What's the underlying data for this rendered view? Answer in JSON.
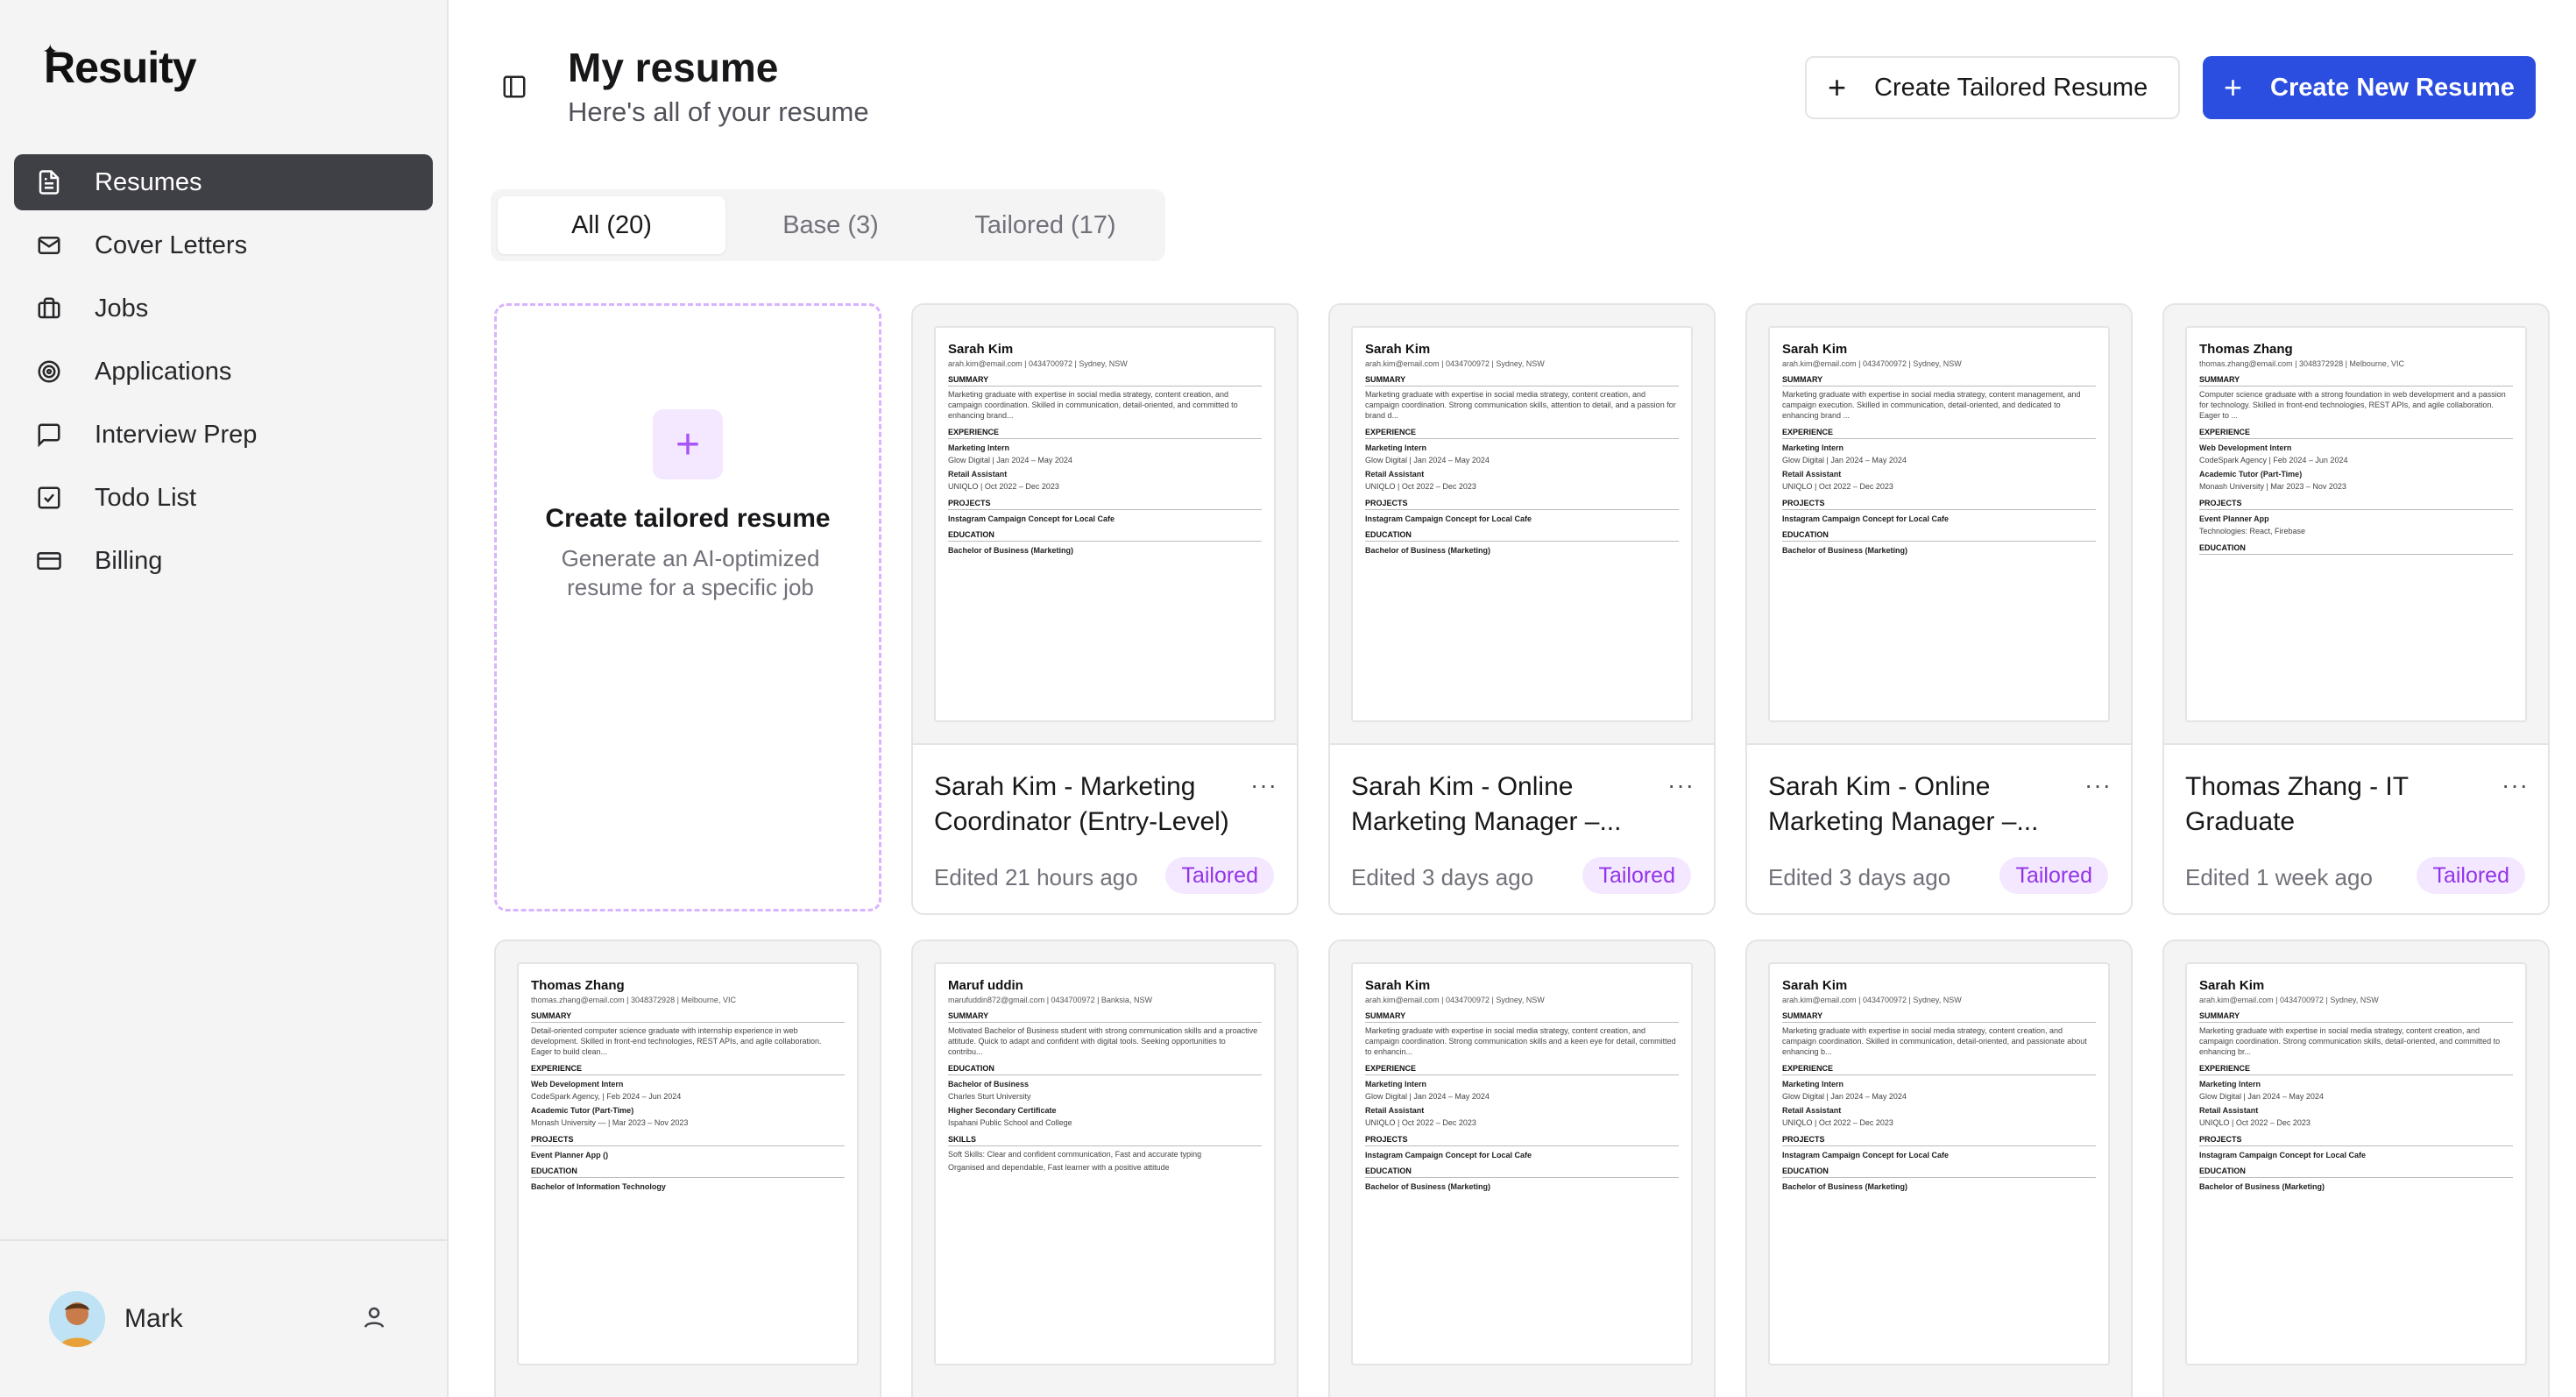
{
  "app": {
    "name": "Resuity"
  },
  "sidebar": {
    "items": [
      {
        "label": "Resumes",
        "icon": "file-text-icon",
        "active": true
      },
      {
        "label": "Cover Letters",
        "icon": "mail-icon",
        "active": false
      },
      {
        "label": "Jobs",
        "icon": "briefcase-icon",
        "active": false
      },
      {
        "label": "Applications",
        "icon": "target-icon",
        "active": false
      },
      {
        "label": "Interview Prep",
        "icon": "message-square-icon",
        "active": false
      },
      {
        "label": "Todo List",
        "icon": "check-square-icon",
        "active": false
      },
      {
        "label": "Billing",
        "icon": "credit-card-icon",
        "active": false
      }
    ],
    "user": {
      "name": "Mark"
    }
  },
  "header": {
    "title": "My resume",
    "subtitle": "Here's all of your resume",
    "tailored_button": "Create Tailored Resume",
    "new_button": "Create New Resume"
  },
  "tabs": [
    {
      "label": "All (20)",
      "active": true
    },
    {
      "label": "Base (3)",
      "active": false
    },
    {
      "label": "Tailored (17)",
      "active": false
    }
  ],
  "create_card": {
    "title": "Create tailored resume",
    "description": "Generate an AI-optimized resume for a specific job"
  },
  "cards": [
    {
      "title": "Sarah Kim - Marketing Coordinator (Entry-Level)",
      "edited": "Edited 21 hours ago",
      "badge": "Tailored",
      "preview": {
        "name": "Sarah Kim",
        "contact": "arah.kim@email.com | 0434700972 | Sydney, NSW",
        "summary": "Marketing graduate with expertise in social media strategy, content creation, and campaign coordination. Skilled in communication, detail-oriented, and committed to enhancing brand...",
        "job1": "Marketing Intern",
        "job1_meta": "Glow Digital | Jan 2024 – May 2024",
        "job2": "Retail Assistant",
        "job2_meta": "UNIQLO | Oct 2022 – Dec 2023",
        "project": "Instagram Campaign Concept for Local Cafe",
        "degree": "Bachelor of Business (Marketing)"
      }
    },
    {
      "title": "Sarah Kim - Online Marketing Manager –...",
      "edited": "Edited 3 days ago",
      "badge": "Tailored",
      "preview": {
        "name": "Sarah Kim",
        "contact": "arah.kim@email.com | 0434700972 | Sydney, NSW",
        "summary": "Marketing graduate with expertise in social media strategy, content creation, and campaign coordination. Strong communication skills, attention to detail, and a passion for brand d...",
        "job1": "Marketing Intern",
        "job1_meta": "Glow Digital | Jan 2024 – May 2024",
        "job2": "Retail Assistant",
        "job2_meta": "UNIQLO | Oct 2022 – Dec 2023",
        "project": "Instagram Campaign Concept for Local Cafe",
        "degree": "Bachelor of Business (Marketing)"
      }
    },
    {
      "title": "Sarah Kim - Online Marketing Manager –...",
      "edited": "Edited 3 days ago",
      "badge": "Tailored",
      "preview": {
        "name": "Sarah Kim",
        "contact": "arah.kim@email.com | 0434700972 | Sydney, NSW",
        "summary": "Marketing graduate with expertise in social media strategy, content management, and campaign execution. Skilled in communication, detail-oriented, and dedicated to enhancing brand ...",
        "job1": "Marketing Intern",
        "job1_meta": "Glow Digital | Jan 2024 – May 2024",
        "job2": "Retail Assistant",
        "job2_meta": "UNIQLO | Oct 2022 – Dec 2023",
        "project": "Instagram Campaign Concept for Local Cafe",
        "degree": "Bachelor of Business (Marketing)"
      }
    },
    {
      "title": "Thomas Zhang - IT Graduate",
      "edited": "Edited 1 week ago",
      "badge": "Tailored",
      "preview": {
        "name": "Thomas Zhang",
        "contact": "thomas.zhang@email.com | 3048372928 | Melbourne, VIC",
        "summary": "Computer science graduate with a strong foundation in web development and a passion for technology. Skilled in front-end technologies, REST APIs, and agile collaboration. Eager to ...",
        "job1": "Web Development Intern",
        "job1_meta": "CodeSpark Agency | Feb 2024 – Jun 2024",
        "job2": "Academic Tutor (Part-Time)",
        "job2_meta": "Monash University | Mar 2023 – Nov 2023",
        "project": "Event Planner App",
        "degree": "Technologies: React, Firebase"
      }
    }
  ],
  "row2": [
    {
      "name": "Thomas Zhang",
      "contact": "thomas.zhang@email.com | 3048372928 | Melbourne, VIC",
      "summary": "Detail-oriented computer science graduate with internship experience in web development. Skilled in front-end technologies, REST APIs, and agile collaboration. Eager to build clean...",
      "job1": "Web Development Intern",
      "job1_meta": "CodeSpark Agency, | Feb 2024 – Jun 2024",
      "job2": "Academic Tutor (Part-Time)",
      "job2_meta": "Monash University — | Mar 2023 – Nov 2023",
      "project": "Event Planner App ()",
      "degree": "Bachelor of Information Technology"
    },
    {
      "name": "Maruf uddin",
      "contact": "marufuddin872@gmail.com | 0434700972 | Banksia, NSW",
      "summary": "Motivated Bachelor of Business student with strong communication skills and a proactive attitude. Quick to adapt and confident with digital tools. Seeking opportunities to contribu...",
      "job1": "Bachelor of Business",
      "job1_meta": "Charles Sturt University",
      "job2": "Higher Secondary Certificate",
      "job2_meta": "Ispahani Public School and College",
      "project": "Soft Skills: Clear and confident communication, Fast and accurate typing",
      "degree": "Organised and dependable, Fast learner with a positive attitude"
    },
    {
      "name": "Sarah Kim",
      "contact": "arah.kim@email.com | 0434700972 | Sydney, NSW",
      "summary": "Marketing graduate with expertise in social media strategy, content creation, and campaign coordination. Strong communication skills and a keen eye for detail, committed to enhancin...",
      "job1": "Marketing Intern",
      "job1_meta": "Glow Digital | Jan 2024 – May 2024",
      "job2": "Retail Assistant",
      "job2_meta": "UNIQLO | Oct 2022 – Dec 2023",
      "project": "Instagram Campaign Concept for Local Cafe",
      "degree": "Bachelor of Business (Marketing)"
    },
    {
      "name": "Sarah Kim",
      "contact": "arah.kim@email.com | 0434700972 | Sydney, NSW",
      "summary": "Marketing graduate with expertise in social media strategy, content creation, and campaign coordination. Skilled in communication, detail-oriented, and passionate about enhancing b...",
      "job1": "Marketing Intern",
      "job1_meta": "Glow Digital | Jan 2024 – May 2024",
      "job2": "Retail Assistant",
      "job2_meta": "UNIQLO | Oct 2022 – Dec 2023",
      "project": "Instagram Campaign Concept for Local Cafe",
      "degree": "Bachelor of Business (Marketing)"
    },
    {
      "name": "Sarah Kim",
      "contact": "arah.kim@email.com | 0434700972 | Sydney, NSW",
      "summary": "Marketing graduate with expertise in social media strategy, content creation, and campaign coordination. Strong communication skills, detail-oriented, and committed to enhancing br...",
      "job1": "Marketing Intern",
      "job1_meta": "Glow Digital | Jan 2024 – May 2024",
      "job2": "Retail Assistant",
      "job2_meta": "UNIQLO | Oct 2022 – Dec 2023",
      "project": "Instagram Campaign Concept for Local Cafe",
      "degree": "Bachelor of Business (Marketing)"
    }
  ],
  "labels": {
    "summary": "SUMMARY",
    "experience": "EXPERIENCE",
    "projects": "PROJECTS",
    "education": "EDUCATION",
    "skills": "SKILLS",
    "menu": "···"
  },
  "colors": {
    "primary": "#2b4ee0",
    "accent": "#a855f7",
    "badge_bg": "#f3e8ff",
    "sidebar_active": "#3f3f46"
  }
}
